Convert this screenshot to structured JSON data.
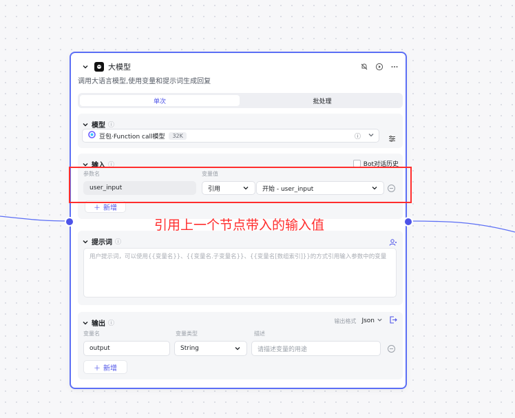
{
  "node": {
    "title": "大模型",
    "description": "调用大语言模型,使用变量和提示词生成回复",
    "tabs": {
      "single": "单次",
      "batch": "批处理"
    }
  },
  "model": {
    "section_title": "模型",
    "model_name": "豆包·Function call模型",
    "model_badge": "32K"
  },
  "input": {
    "section_title": "输入",
    "bot_history_label": "Bot对话历史",
    "param_name_header": "参数名",
    "var_value_header": "变量值",
    "param_name": "user_input",
    "ref_type": "引用",
    "ref_value": "开始 - user_input",
    "add_label": "新增"
  },
  "prompt": {
    "section_title": "提示词",
    "placeholder": "用户提示词，可以使用{{变量名}}、{{变量名.子变量名}}、{{变量名[数组索引]}}的方式引用输入参数中的变量"
  },
  "output": {
    "section_title": "输出",
    "format_label": "输出格式",
    "format_value": "Json",
    "var_name_header": "变量名",
    "var_type_header": "变量类型",
    "desc_header": "描述",
    "var_name": "output",
    "var_type": "String",
    "desc_placeholder": "请描述变量的用途",
    "add_label": "新增"
  },
  "annotation": {
    "text": "引用上一个节点带入的输入值"
  },
  "colors": {
    "accent": "#4d53e8",
    "node_border": "#5b6ef5",
    "annotation_red": "#ff2d2d"
  }
}
